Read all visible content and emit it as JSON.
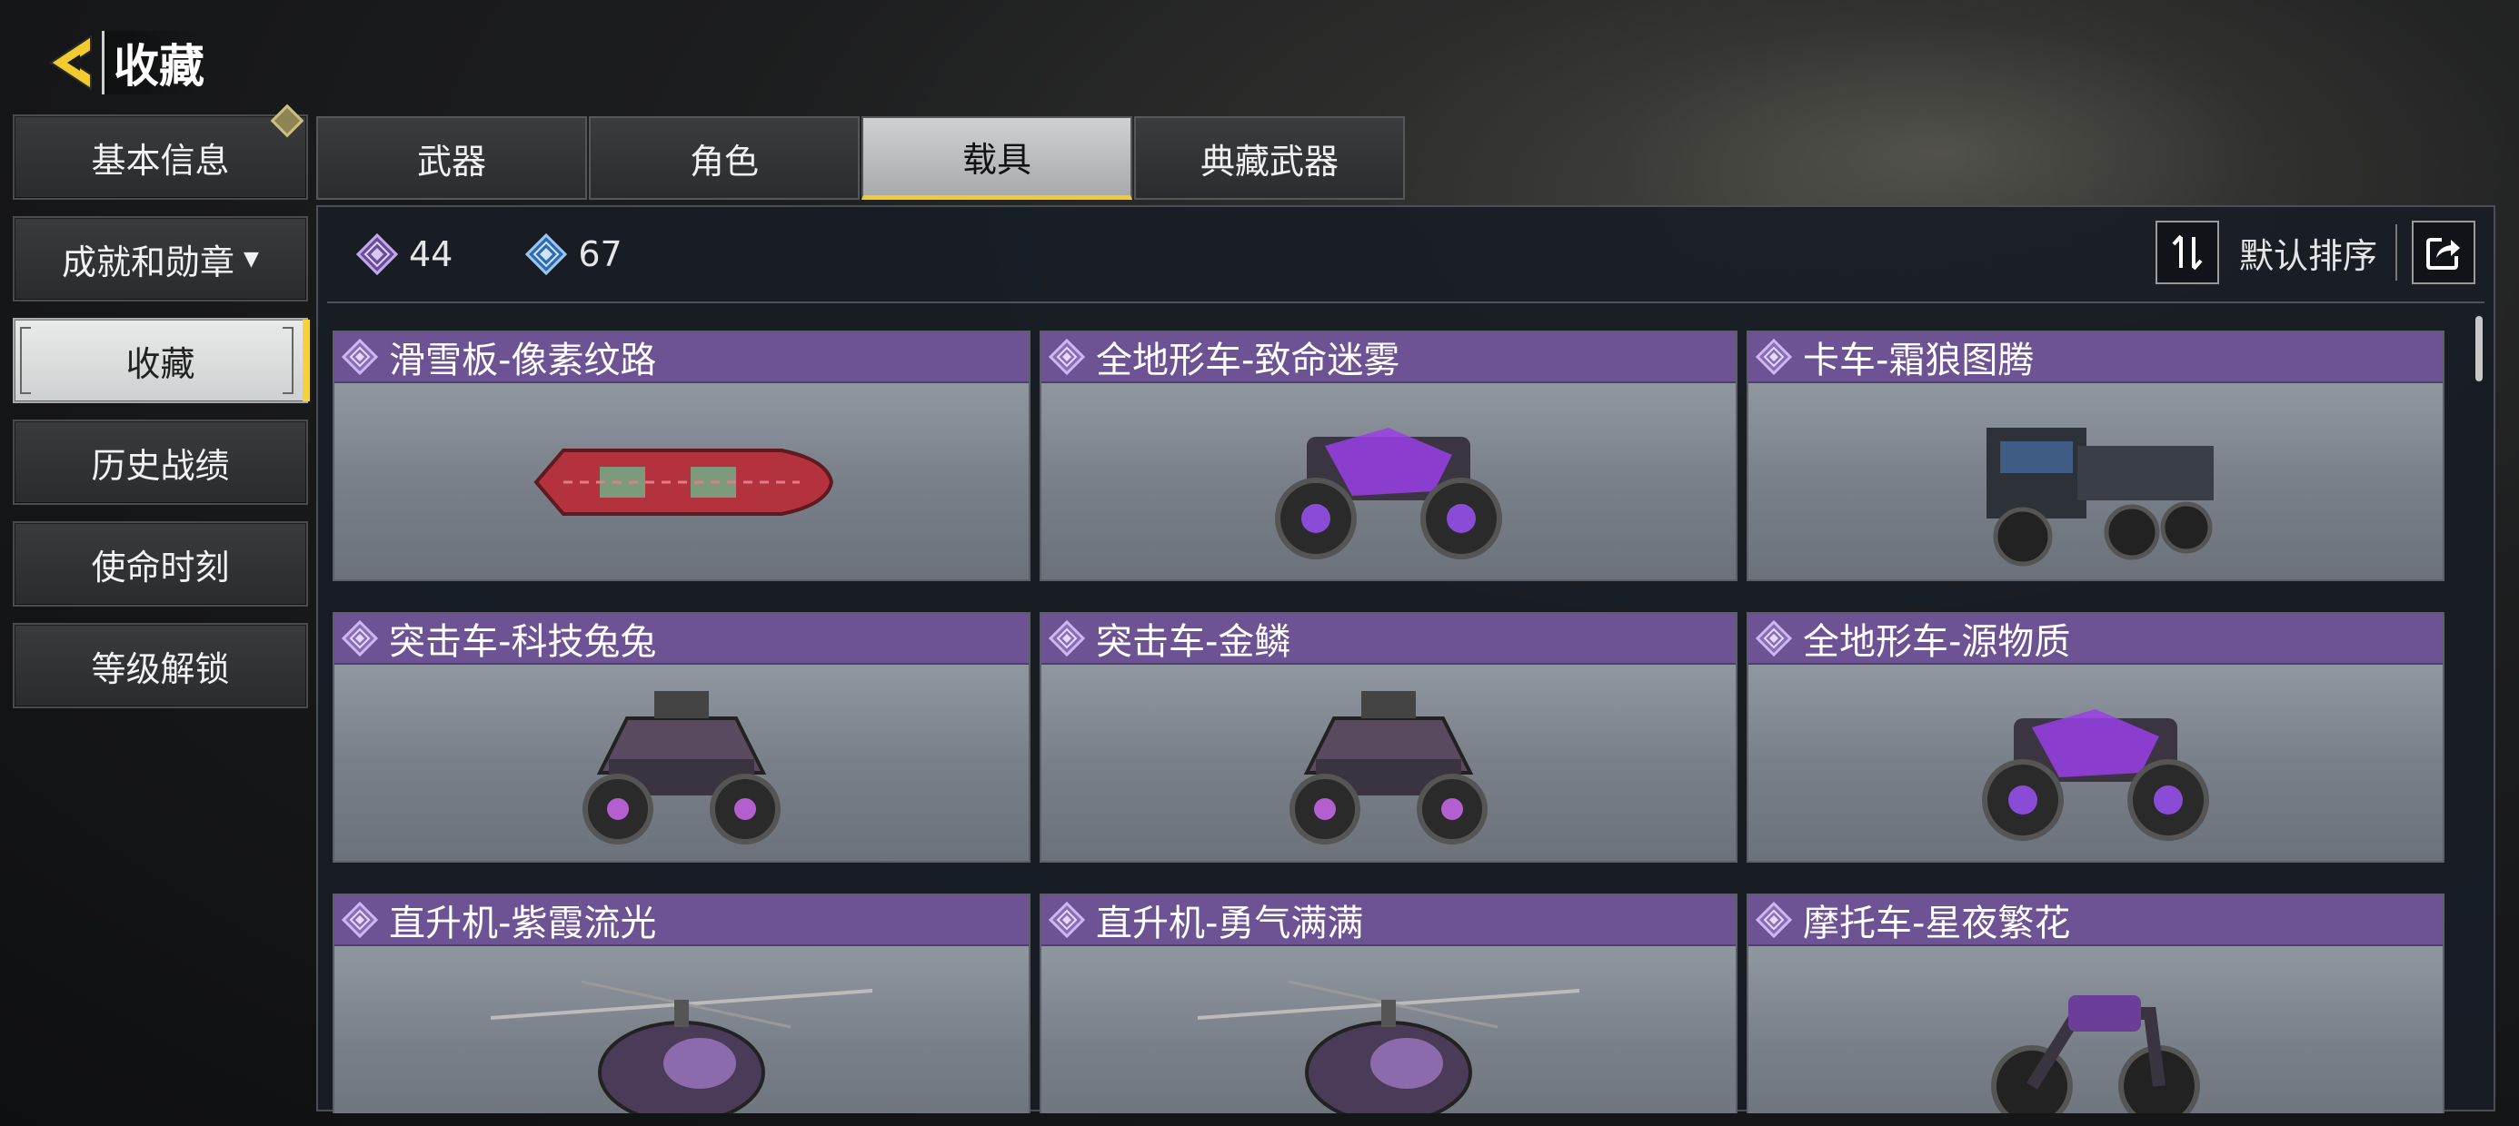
{
  "header": {
    "title": "收藏"
  },
  "sidebar": {
    "items": [
      {
        "label": "基本信息"
      },
      {
        "label": "成就和勋章"
      },
      {
        "label": "收藏"
      },
      {
        "label": "历史战绩"
      },
      {
        "label": "使命时刻"
      },
      {
        "label": "等级解锁"
      }
    ],
    "active_index": 2
  },
  "tabs": [
    {
      "label": "武器"
    },
    {
      "label": "角色"
    },
    {
      "label": "载具"
    },
    {
      "label": "典藏武器"
    }
  ],
  "active_tab": 2,
  "stats": {
    "purple_count": "44",
    "blue_count": "67"
  },
  "sort": {
    "label": "默认排序"
  },
  "cards": [
    {
      "name": "滑雪板-像素纹路",
      "kind": "snowboard",
      "icon": "rarity-diamond-icon"
    },
    {
      "name": "全地形车-致命迷雾",
      "kind": "atv",
      "icon": "rarity-diamond-icon"
    },
    {
      "name": "卡车-霜狼图腾",
      "kind": "truck",
      "icon": "rarity-diamond-icon"
    },
    {
      "name": "突击车-科技兔兔",
      "kind": "buggy",
      "icon": "rarity-diamond-icon"
    },
    {
      "name": "突击车-金鳞",
      "kind": "buggy",
      "icon": "rarity-diamond-icon"
    },
    {
      "name": "全地形车-源物质",
      "kind": "atv",
      "icon": "rarity-diamond-icon"
    },
    {
      "name": "直升机-紫霞流光",
      "kind": "helicopter",
      "icon": "rarity-diamond-icon"
    },
    {
      "name": "直升机-勇气满满",
      "kind": "helicopter",
      "icon": "rarity-diamond-icon"
    },
    {
      "name": "摩托车-星夜繁花",
      "kind": "motorcycle",
      "icon": "rarity-diamond-icon"
    }
  ],
  "colors": {
    "accent_yellow": "#f2cc2e",
    "card_header_purple": "#6d5294",
    "panel_bg": "#181d25"
  }
}
